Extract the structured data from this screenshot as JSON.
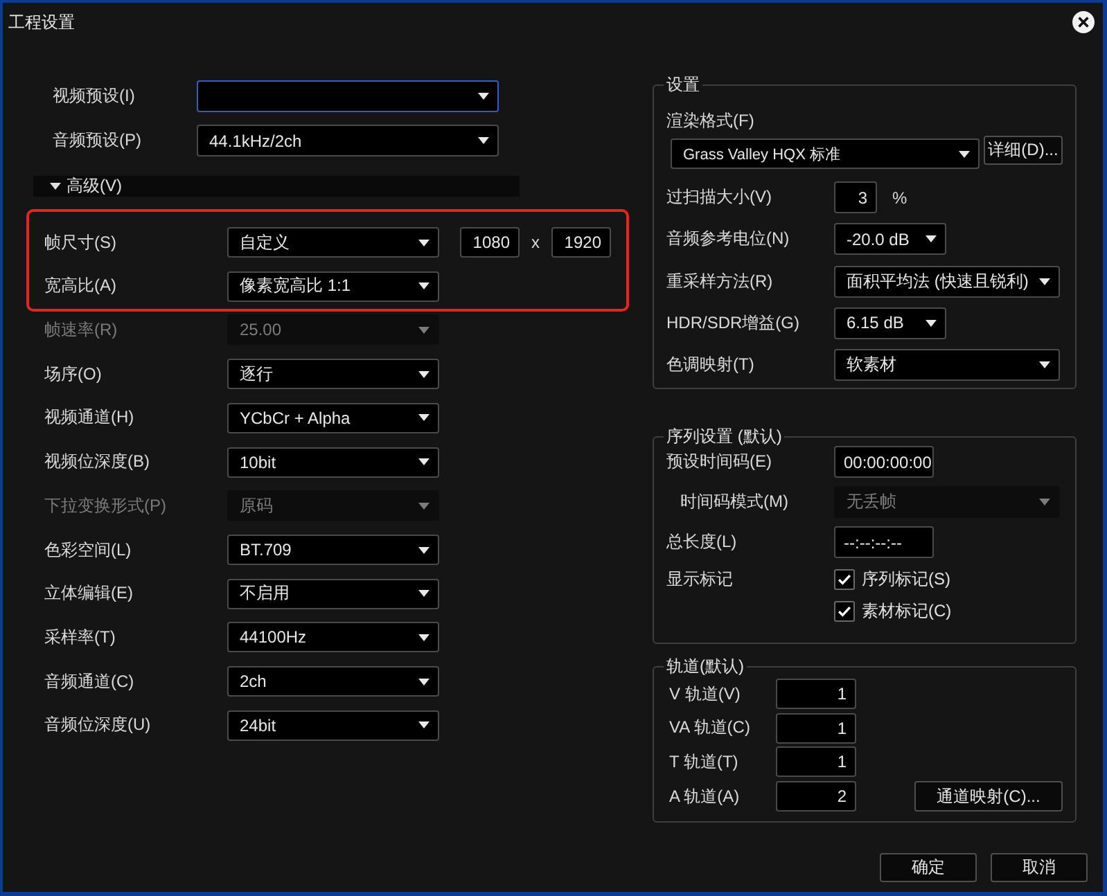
{
  "window": {
    "title": "工程设置"
  },
  "presets": [
    {
      "label": "视频预设(I)",
      "focused": true
    },
    {
      "label": "音频预设(P)",
      "value": "44.1kHz/2ch",
      "focused": false
    }
  ],
  "advanced": {
    "label": "高级(V)",
    "expanded": true,
    "rows": [
      {
        "kind": "frame_size",
        "label": "帧尺寸(S)",
        "value": "自定义",
        "inputs": [
          "1080",
          "1920"
        ],
        "separator": "x",
        "disabled": false,
        "highlighted": true
      },
      {
        "kind": "dropdown",
        "label": "宽高比(A)",
        "value": "像素宽高比 1:1",
        "disabled": false,
        "highlighted": true
      },
      {
        "kind": "dropdown",
        "label": "帧速率(R)",
        "value": "25.00",
        "disabled": true,
        "highlighted": false
      },
      {
        "kind": "dropdown",
        "label": "场序(O)",
        "value": "逐行",
        "disabled": false,
        "highlighted": false
      },
      {
        "kind": "dropdown",
        "label": "视频通道(H)",
        "value": "YCbCr + Alpha",
        "disabled": false,
        "highlighted": false
      },
      {
        "kind": "dropdown",
        "label": "视频位深度(B)",
        "value": "10bit",
        "disabled": false,
        "highlighted": false
      },
      {
        "kind": "dropdown",
        "label": "下拉变换形式(P)",
        "value": "原码",
        "disabled": true,
        "highlighted": false
      },
      {
        "kind": "dropdown",
        "label": "色彩空间(L)",
        "value": "BT.709",
        "disabled": false,
        "highlighted": false
      },
      {
        "kind": "dropdown",
        "label": "立体编辑(E)",
        "value": "不启用",
        "disabled": false,
        "highlighted": false
      },
      {
        "kind": "dropdown",
        "label": "采样率(T)",
        "value": "44100Hz",
        "disabled": false,
        "highlighted": false
      },
      {
        "kind": "dropdown",
        "label": "音频通道(C)",
        "value": "2ch",
        "disabled": false,
        "highlighted": false
      },
      {
        "kind": "dropdown",
        "label": "音频位深度(U)",
        "value": "24bit",
        "disabled": false,
        "highlighted": false
      }
    ]
  },
  "settings_group": {
    "title": "设置",
    "render_format": {
      "label": "渲染格式(F)",
      "value": "Grass Valley HQX 标准",
      "button": "详细(D)..."
    },
    "rows": [
      {
        "kind": "input",
        "label": "过扫描大小(V)",
        "value": "3",
        "unit": "%"
      },
      {
        "kind": "compact",
        "label": "音频参考电位(N)",
        "value": "-20.0 dB"
      },
      {
        "kind": "dropdown",
        "label": "重采样方法(R)",
        "value": "面积平均法 (快速且锐利)"
      },
      {
        "kind": "compact",
        "label": "HDR/SDR增益(G)",
        "value": "6.15 dB"
      },
      {
        "kind": "dropdown",
        "label": "色调映射(T)",
        "value": "软素材"
      }
    ]
  },
  "sequence_group": {
    "title": "序列设置 (默认)",
    "rows": [
      {
        "kind": "input",
        "label": "预设时间码(E)",
        "value": "00:00:00:00",
        "children": [
          {
            "kind": "dropdown",
            "label": "时间码模式(M)",
            "value": "无丢帧",
            "disabled": true
          }
        ]
      },
      {
        "kind": "input",
        "label": "总长度(L)",
        "value": "--:--:--:--"
      },
      {
        "kind": "checks",
        "label": "显示标记",
        "options": [
          {
            "label": "序列标记(S)",
            "checked": true
          },
          {
            "label": "素材标记(C)",
            "checked": true
          }
        ]
      }
    ]
  },
  "tracks_group": {
    "title": "轨道(默认)",
    "rows": [
      {
        "label": "V 轨道(V)",
        "value": "1"
      },
      {
        "label": "VA 轨道(C)",
        "value": "1"
      },
      {
        "label": "T 轨道(T)",
        "value": "1"
      },
      {
        "label": "A 轨道(A)",
        "value": "2"
      }
    ],
    "button": "通道映射(C)..."
  },
  "buttons": [
    "确定",
    "取消"
  ]
}
